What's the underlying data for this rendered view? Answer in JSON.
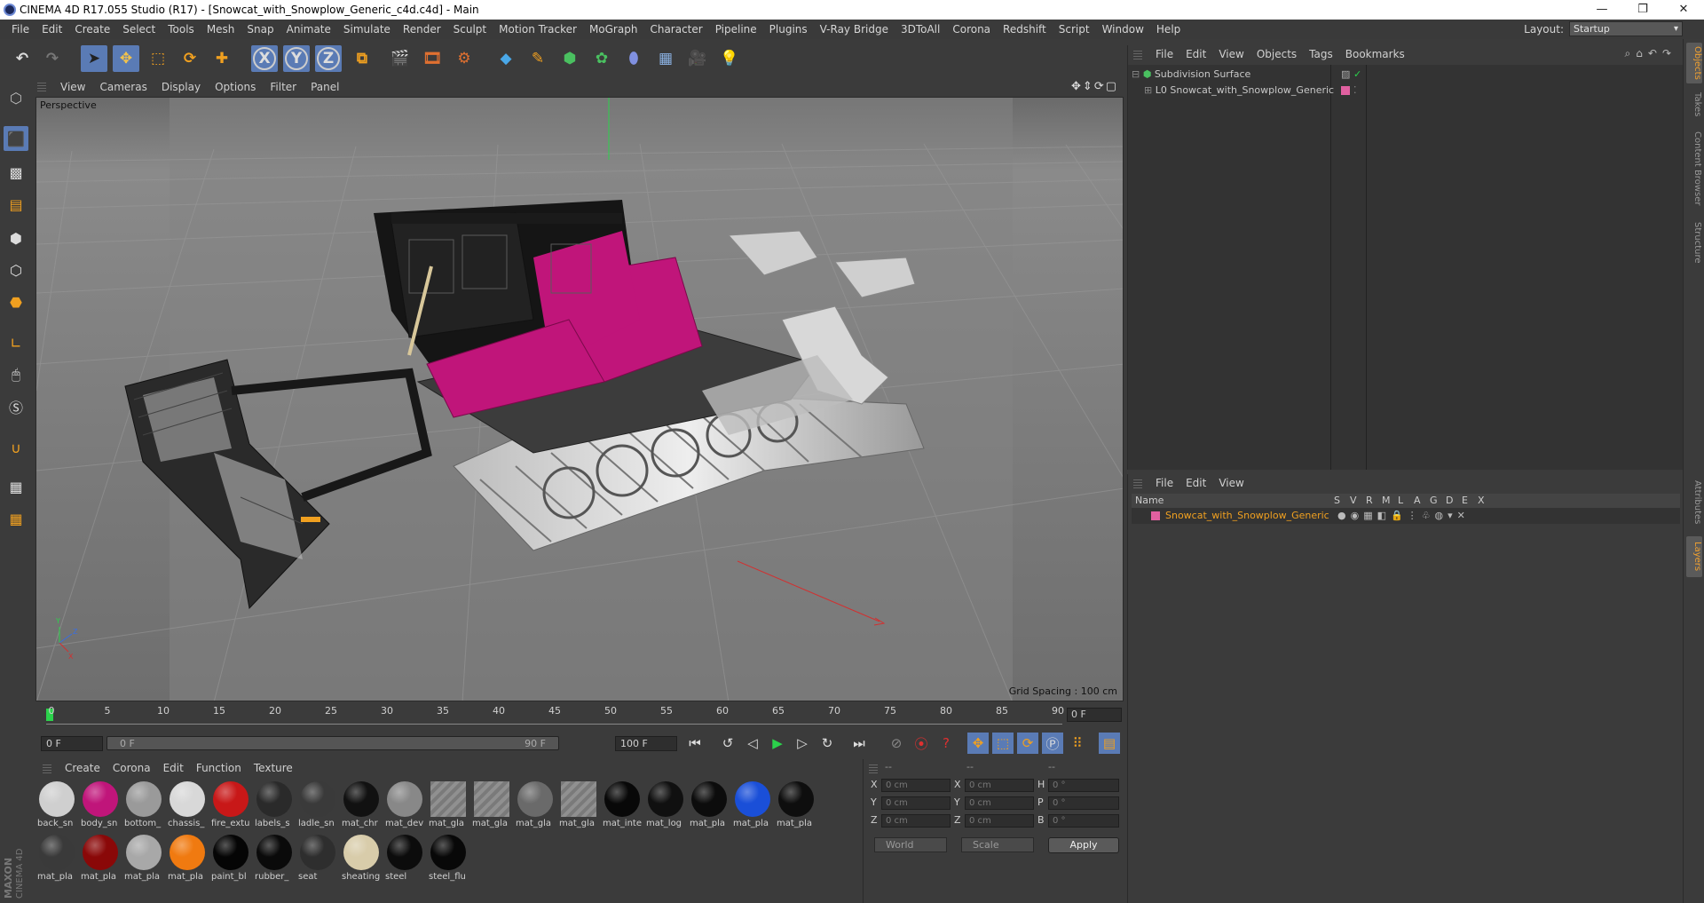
{
  "window": {
    "title": "CINEMA 4D R17.055 Studio (R17) - [Snowcat_with_Snowplow_Generic_c4d.c4d] - Main",
    "controls": [
      "—",
      "❐",
      "✕"
    ]
  },
  "menubar": {
    "items": [
      "File",
      "Edit",
      "Create",
      "Select",
      "Tools",
      "Mesh",
      "Snap",
      "Animate",
      "Simulate",
      "Render",
      "Sculpt",
      "Motion Tracker",
      "MoGraph",
      "Character",
      "Pipeline",
      "Plugins",
      "V-Ray Bridge",
      "3DToAll",
      "Corona",
      "Redshift",
      "Script",
      "Window",
      "Help"
    ],
    "layout_label": "Layout:",
    "layout_value": "Startup"
  },
  "toolbar": {
    "axis_x": "X",
    "axis_y": "Y",
    "axis_z": "Z"
  },
  "viewport": {
    "menu": [
      "View",
      "Cameras",
      "Display",
      "Options",
      "Filter",
      "Panel"
    ],
    "label": "Perspective",
    "grid_spacing": "Grid Spacing : 100 cm",
    "colors": {
      "body": "#c0157a",
      "bg": "#7c7c7c"
    }
  },
  "timeline": {
    "ticks": [
      "0",
      "5",
      "10",
      "15",
      "20",
      "25",
      "30",
      "35",
      "40",
      "45",
      "50",
      "55",
      "60",
      "65",
      "70",
      "75",
      "80",
      "85",
      "90"
    ],
    "current_frame": "0 F",
    "start_field": "0 F",
    "range_start": "0 F",
    "range_end": "90 F",
    "end_field": "100 F"
  },
  "materials": {
    "menu": [
      "Create",
      "Corona",
      "Edit",
      "Function",
      "Texture"
    ],
    "row1": [
      {
        "label": "back_sn",
        "color": "#cfcfcf"
      },
      {
        "label": "body_sn",
        "color": "#c0157a"
      },
      {
        "label": "bottom_",
        "color": "#9a9a9a"
      },
      {
        "label": "chassis_",
        "color": "#d8d8d8"
      },
      {
        "label": "fire_extu",
        "color": "#c81818"
      },
      {
        "label": "labels_s",
        "color": "#2a2a2a"
      },
      {
        "label": "ladle_sn",
        "color": "#3a3a3a"
      },
      {
        "label": "mat_chr",
        "color": "#111111"
      },
      {
        "label": "mat_dev",
        "color": "#888888"
      },
      {
        "label": "mat_gla",
        "color": "hatch"
      },
      {
        "label": "mat_gla",
        "color": "hatch"
      },
      {
        "label": "mat_gla",
        "color": "#6a6a6a"
      },
      {
        "label": "mat_gla",
        "color": "hatch"
      },
      {
        "label": "mat_inte",
        "color": "#080808"
      },
      {
        "label": "mat_log",
        "color": "#101010"
      },
      {
        "label": "mat_pla",
        "color": "#0c0c0c"
      },
      {
        "label": "mat_pla",
        "color": "#1a4fd8"
      },
      {
        "label": "mat_pla",
        "color": "#0e0e0e"
      }
    ],
    "row2": [
      {
        "label": "mat_pla",
        "color": "#3a3a3a"
      },
      {
        "label": "mat_pla",
        "color": "#8a0808"
      },
      {
        "label": "mat_pla",
        "color": "#a8a8a8"
      },
      {
        "label": "mat_pla",
        "color": "#f07a10"
      },
      {
        "label": "paint_bl",
        "color": "#050505"
      },
      {
        "label": "rubber_",
        "color": "#0a0a0a"
      },
      {
        "label": "seat",
        "color": "#2e2e2e"
      },
      {
        "label": "sheating",
        "color": "#d8ccaa"
      },
      {
        "label": "steel",
        "color": "#0c0c0c"
      },
      {
        "label": "steel_flu",
        "color": "#080808"
      }
    ]
  },
  "coords": {
    "headers": [
      "--",
      "--",
      "--"
    ],
    "rows": [
      {
        "a": "X",
        "av": "0 cm",
        "b": "X",
        "bv": "0 cm",
        "c": "H",
        "cv": "0 °"
      },
      {
        "a": "Y",
        "av": "0 cm",
        "b": "Y",
        "bv": "0 cm",
        "c": "P",
        "cv": "0 °"
      },
      {
        "a": "Z",
        "av": "0 cm",
        "b": "Z",
        "bv": "0 cm",
        "c": "B",
        "cv": "0 °"
      }
    ],
    "mode1": "World",
    "mode2": "Scale",
    "apply": "Apply"
  },
  "object_manager": {
    "menu": [
      "File",
      "Edit",
      "View",
      "Objects",
      "Tags",
      "Bookmarks"
    ],
    "objects": [
      {
        "name": "Subdivision Surface",
        "color": "#d0d0d0"
      },
      {
        "name": "Snowcat_with_Snowplow_Generic",
        "color": "#d0d0d0"
      }
    ]
  },
  "layer_manager": {
    "menu": [
      "File",
      "Edit",
      "View"
    ],
    "header_name": "Name",
    "columns": [
      "S",
      "V",
      "R",
      "M",
      "L",
      "A",
      "G",
      "D",
      "E",
      "X"
    ],
    "layer_name": "Snowcat_with_Snowplow_Generic",
    "layer_color": "#e060a0"
  },
  "right_tabs": [
    "Objects",
    "Takes",
    "Content Browser",
    "Structure",
    "Attributes",
    "Layers"
  ]
}
